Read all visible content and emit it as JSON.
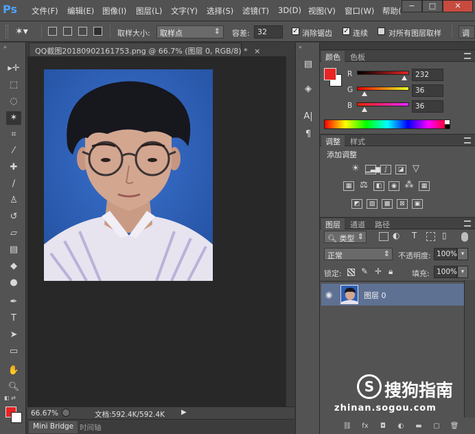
{
  "app": {
    "logo_text": "Ps"
  },
  "menubar": {
    "items": [
      "文件(F)",
      "编辑(E)",
      "图像(I)",
      "图层(L)",
      "文字(Y)",
      "选择(S)",
      "滤镜(T)",
      "3D(D)",
      "视图(V)",
      "窗口(W)",
      "帮助("
    ],
    "window_buttons": [
      "−",
      "□",
      "✕"
    ]
  },
  "options": {
    "sample_size_label": "取样大小:",
    "sample_size_value": "取样点",
    "tolerance_label": "容差:",
    "tolerance_value": "32",
    "antialias_label": "消除锯齿",
    "contiguous_label": "连续",
    "sample_all_label": "对所有图层取样",
    "refine_label": "调"
  },
  "document": {
    "tab_title": "QQ截图20180902161753.png @ 66.7% (图层 0, RGB/8) *",
    "zoom": "66.67%",
    "doc_info": "文档:592.4K/592.4K"
  },
  "bottom_tabs": [
    "Mini Bridge",
    "时间轴"
  ],
  "color_panel": {
    "tabs": [
      "颜色",
      "色板"
    ],
    "channels": [
      {
        "label": "R",
        "value": "232"
      },
      {
        "label": "G",
        "value": "36"
      },
      {
        "label": "B",
        "value": "36"
      }
    ],
    "fg_color": "#e82424",
    "bg_color": "#ffffff"
  },
  "adjust_panel": {
    "tabs": [
      "调整",
      "样式"
    ],
    "title": "添加调整"
  },
  "layers_panel": {
    "tabs": [
      "图层",
      "通道",
      "路径"
    ],
    "filter_label": "类型",
    "blend_mode": "正常",
    "opacity_label": "不透明度:",
    "opacity_value": "100%",
    "lock_label": "锁定:",
    "fill_label": "填充:",
    "fill_value": "100%",
    "layers": [
      {
        "name": "图层 0"
      }
    ]
  },
  "watermark": {
    "logo": "S",
    "text": "搜狗指南",
    "url": "zhinan.sogou.com"
  }
}
